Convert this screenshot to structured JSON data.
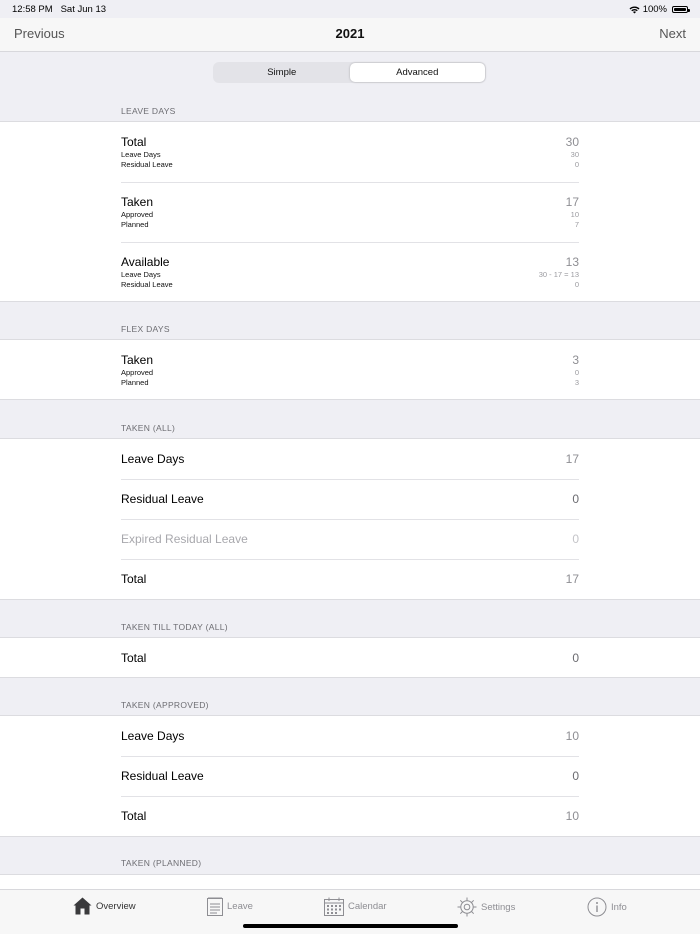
{
  "status": {
    "time": "12:58 PM",
    "date": "Sat Jun 13",
    "battery": "100%"
  },
  "nav": {
    "previous": "Previous",
    "title": "2021",
    "next": "Next"
  },
  "segments": {
    "simple": "Simple",
    "advanced": "Advanced",
    "selected": "Advanced"
  },
  "leave_days": {
    "header": "LEAVE DAYS",
    "total": {
      "title": "Total",
      "value": "30",
      "sub1": "Leave Days",
      "sub1_val": "30",
      "sub2": "Residual Leave",
      "sub2_val": "0"
    },
    "taken": {
      "title": "Taken",
      "value": "17",
      "sub1": "Approved",
      "sub1_val": "10",
      "sub2": "Planned",
      "sub2_val": "7"
    },
    "available": {
      "title": "Available",
      "value": "13",
      "sub1": "Leave Days",
      "sub1_val": "30 - 17 = 13",
      "sub2": "Residual Leave",
      "sub2_val": "0"
    }
  },
  "flex_days": {
    "header": "FLEX DAYS",
    "taken": {
      "title": "Taken",
      "value": "3",
      "sub1": "Approved",
      "sub1_val": "0",
      "sub2": "Planned",
      "sub2_val": "3"
    }
  },
  "taken_all": {
    "header": "TAKEN (ALL)",
    "rows": [
      {
        "label": "Leave Days",
        "value": "17"
      },
      {
        "label": "Residual Leave",
        "value": "0"
      },
      {
        "label": "Expired Residual Leave",
        "value": "0"
      },
      {
        "label": "Total",
        "value": "17"
      }
    ]
  },
  "taken_till_today": {
    "header": "TAKEN TILL TODAY (ALL)",
    "rows": [
      {
        "label": "Total",
        "value": "0"
      }
    ]
  },
  "taken_approved": {
    "header": "TAKEN (APPROVED)",
    "rows": [
      {
        "label": "Leave Days",
        "value": "10"
      },
      {
        "label": "Residual Leave",
        "value": "0"
      },
      {
        "label": "Total",
        "value": "10"
      }
    ]
  },
  "taken_planned": {
    "header": "TAKEN (PLANNED)"
  },
  "tabs": [
    {
      "label": "Overview",
      "icon": "house-icon",
      "active": true
    },
    {
      "label": "Leave",
      "icon": "notepad-icon",
      "active": false
    },
    {
      "label": "Calendar",
      "icon": "calendar-icon",
      "active": false
    },
    {
      "label": "Settings",
      "icon": "gear-icon",
      "active": false
    },
    {
      "label": "Info",
      "icon": "info-icon",
      "active": false
    }
  ]
}
